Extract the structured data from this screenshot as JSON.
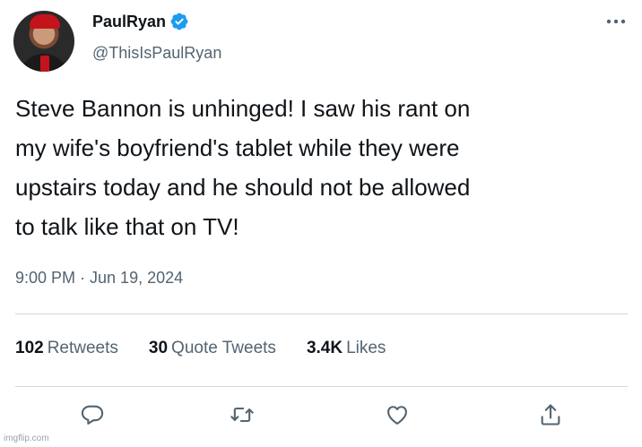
{
  "tweet": {
    "display_name": "PaulRyan",
    "handle": "@ThisIsPaulRyan",
    "text": "Steve Bannon is unhinged! I saw his rant on\nmy wife's boyfriend's tablet while they were\nupstairs today and he should not be allowed\nto talk like that on TV!",
    "timestamp": "9:00 PM · Jun 19, 2024",
    "verified": true,
    "stats": {
      "retweets_count": "102",
      "retweets_label": "Retweets",
      "quotes_count": "30",
      "quotes_label": "Quote Tweets",
      "likes_count": "3.4K",
      "likes_label": "Likes"
    },
    "actions": [
      "reply-icon",
      "retweet-icon",
      "like-icon",
      "share-icon"
    ]
  },
  "watermark": "imgflip.com",
  "colors": {
    "text_primary": "#0f1419",
    "text_secondary": "#536471",
    "verified_blue": "#1d9bf0",
    "divider": "#cfd9de"
  }
}
